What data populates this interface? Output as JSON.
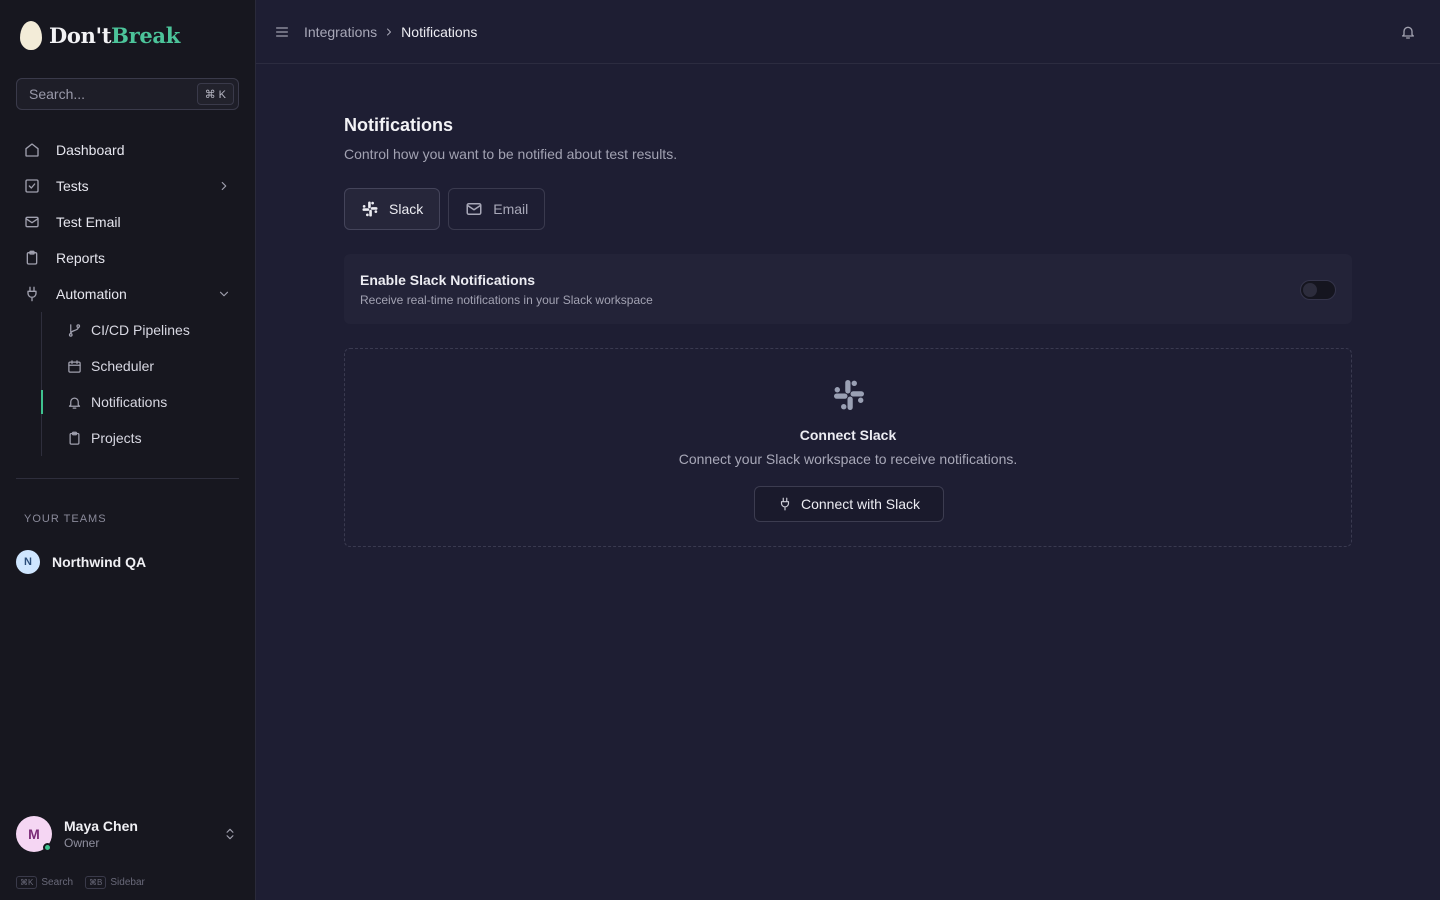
{
  "brand": {
    "name_a": "Don't",
    "name_b": "Break"
  },
  "search": {
    "placeholder": "Search...",
    "shortcut": "⌘ K"
  },
  "nav": {
    "items": [
      {
        "label": "Dashboard",
        "icon": "home-icon"
      },
      {
        "label": "Tests",
        "icon": "checkbox-icon"
      },
      {
        "label": "Test Email",
        "icon": "mail-icon"
      },
      {
        "label": "Reports",
        "icon": "clipboard-icon"
      },
      {
        "label": "Automation",
        "icon": "plug-icon"
      }
    ],
    "sub_items": [
      {
        "label": "CI/CD Pipelines",
        "icon": "git-branch-icon"
      },
      {
        "label": "Scheduler",
        "icon": "calendar-icon"
      },
      {
        "label": "Notifications",
        "icon": "bell-icon",
        "active": true
      },
      {
        "label": "Projects",
        "icon": "clipboard-icon"
      }
    ]
  },
  "teams": {
    "label": "YOUR TEAMS",
    "team_name": "Northwind QA",
    "team_initial": "N"
  },
  "user": {
    "name": "Maya Chen",
    "role": "Owner",
    "initial": "M"
  },
  "shortcuts": {
    "search_key": "⌘K",
    "search_label": "Search",
    "sidebar_key": "⌘B",
    "sidebar_label": "Sidebar"
  },
  "header": {
    "crumb_parent": "Integrations",
    "crumb_current": "Notifications"
  },
  "main": {
    "title": "Notifications",
    "subtitle": "Control how you want to be notified about test results.",
    "tabs": [
      {
        "label": "Slack",
        "active": true
      },
      {
        "label": "Email",
        "active": false
      }
    ],
    "toggle": {
      "title": "Enable Slack Notifications",
      "description": "Receive real-time notifications in your Slack workspace",
      "enabled": false
    },
    "connect": {
      "title": "Connect Slack",
      "description": "Connect your Slack workspace to receive notifications.",
      "button": "Connect with Slack"
    }
  },
  "colors": {
    "accent": "#3fc28f",
    "brand_b": "#4cc49a",
    "background": "#1e1e33",
    "sidebar": "#17171f"
  }
}
